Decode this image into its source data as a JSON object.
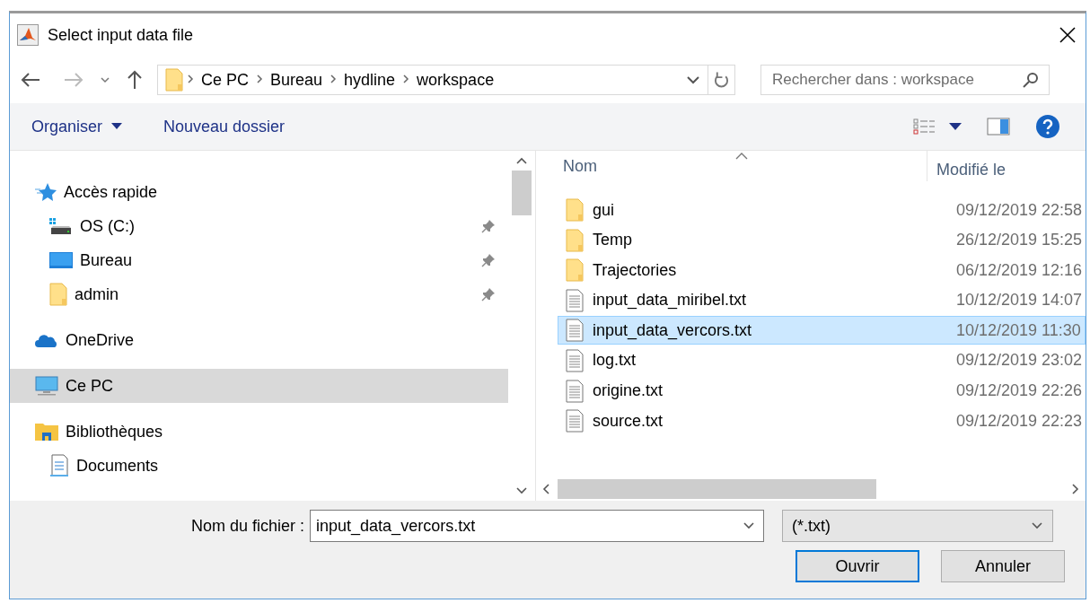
{
  "window": {
    "title": "Select input data file"
  },
  "address": {
    "segments": [
      "Ce PC",
      "Bureau",
      "hydline",
      "workspace"
    ]
  },
  "search": {
    "placeholder": "Rechercher dans : workspace"
  },
  "toolbar": {
    "organize": "Organiser",
    "new_folder": "Nouveau dossier"
  },
  "sidebar": {
    "items": [
      {
        "label": "Accès rapide",
        "kind": "quick",
        "selected": false,
        "children": [
          {
            "label": "OS (C:)",
            "kind": "drive",
            "pinned": true,
            "selected": false
          },
          {
            "label": "Bureau",
            "kind": "desktop",
            "pinned": true,
            "selected": false
          },
          {
            "label": "admin",
            "kind": "folder",
            "pinned": true,
            "selected": false
          }
        ]
      },
      {
        "label": "OneDrive",
        "kind": "cloud",
        "selected": false
      },
      {
        "label": "Ce PC",
        "kind": "pc",
        "selected": true
      },
      {
        "label": "Bibliothèques",
        "kind": "library",
        "selected": false,
        "children": [
          {
            "label": "Documents",
            "kind": "documents",
            "pinned": false,
            "selected": false
          }
        ]
      }
    ]
  },
  "files": {
    "columns": [
      "Nom",
      "Modifié le"
    ],
    "rows": [
      {
        "name": "gui",
        "modified": "09/12/2019 22:58",
        "kind": "folder",
        "selected": false
      },
      {
        "name": "Temp",
        "modified": "26/12/2019 15:25",
        "kind": "folder",
        "selected": false
      },
      {
        "name": "Trajectories",
        "modified": "06/12/2019 12:16",
        "kind": "folder",
        "selected": false
      },
      {
        "name": "input_data_miribel.txt",
        "modified": "10/12/2019 14:07",
        "kind": "file",
        "selected": false
      },
      {
        "name": "input_data_vercors.txt",
        "modified": "10/12/2019 11:30",
        "kind": "file",
        "selected": true
      },
      {
        "name": "log.txt",
        "modified": "09/12/2019 23:02",
        "kind": "file",
        "selected": false
      },
      {
        "name": "origine.txt",
        "modified": "09/12/2019 22:26",
        "kind": "file",
        "selected": false
      },
      {
        "name": "source.txt",
        "modified": "09/12/2019 22:23",
        "kind": "file",
        "selected": false
      }
    ]
  },
  "footer": {
    "filename_label": "Nom du fichier :",
    "filename": "input_data_vercors.txt",
    "filetype": "(*.txt)",
    "buttons": [
      {
        "label": "Ouvrir",
        "default": true
      },
      {
        "label": "Annuler",
        "default": false
      }
    ]
  }
}
